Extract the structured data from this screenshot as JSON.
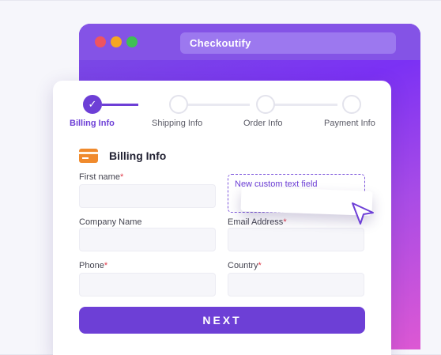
{
  "browser": {
    "address": "Checkoutify",
    "colors": {
      "red": "#ee5461",
      "yellow": "#f5a623",
      "green": "#3fbf55",
      "accent": "#6d3fd6"
    }
  },
  "steps": [
    {
      "label": "Billing Info",
      "state": "completed"
    },
    {
      "label": "Shipping Info",
      "state": "pending"
    },
    {
      "label": "Order Info",
      "state": "pending"
    },
    {
      "label": "Payment Info",
      "state": "pending"
    }
  ],
  "section": {
    "title": "Billing Info",
    "icon": "credit-card-icon"
  },
  "fields": {
    "first_name": {
      "label": "First name",
      "required": "*",
      "value": ""
    },
    "company_name": {
      "label": "Company Name",
      "value": ""
    },
    "email": {
      "label": "Email Address",
      "required": "*",
      "value": ""
    },
    "phone": {
      "label": "Phone",
      "required": "*",
      "value": ""
    },
    "country": {
      "label": "Country",
      "required": "*",
      "value": ""
    }
  },
  "custom_field": {
    "label": "New custom text field"
  },
  "next_button": {
    "label": "NEXT"
  }
}
